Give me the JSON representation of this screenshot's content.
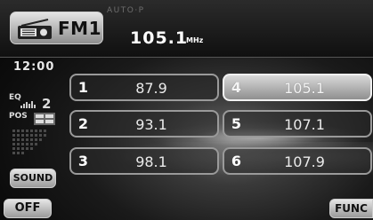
{
  "header": {
    "band_label": "FM1",
    "mode_label": "AUTO·P",
    "frequency": "105.1",
    "frequency_unit": "MHz"
  },
  "status": {
    "clock": "12:00",
    "eq_label": "EQ",
    "eq_value": "2",
    "pos_label": "POS"
  },
  "buttons": {
    "sound": "SOUND",
    "off": "OFF",
    "func": "FUNC"
  },
  "presets": [
    {
      "number": "1",
      "frequency": "87.9",
      "active": false
    },
    {
      "number": "2",
      "frequency": "93.1",
      "active": false
    },
    {
      "number": "3",
      "frequency": "98.1",
      "active": false
    },
    {
      "number": "4",
      "frequency": "105.1",
      "active": true
    },
    {
      "number": "5",
      "frequency": "107.1",
      "active": false
    },
    {
      "number": "6",
      "frequency": "107.9",
      "active": false
    }
  ],
  "icons": {
    "band": "radio-icon",
    "eq": "equalizer-icon",
    "pos": "seat-position-icon"
  }
}
